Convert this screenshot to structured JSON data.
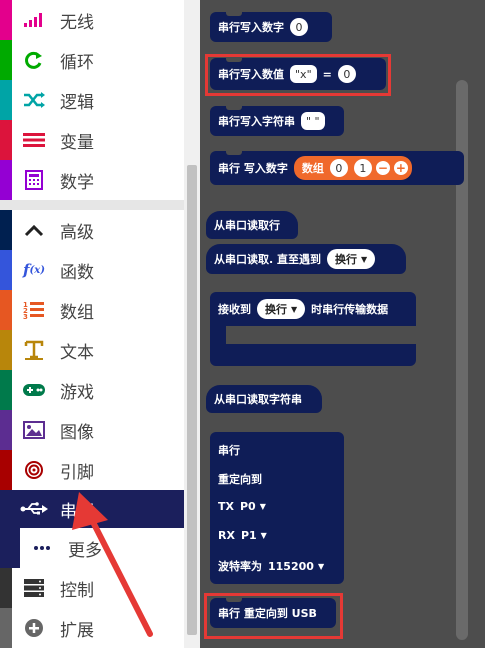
{
  "toolbox": {
    "categories": [
      {
        "label": "无线",
        "icon": "signal-icon",
        "color": "#e3008c"
      },
      {
        "label": "循环",
        "icon": "loop-icon",
        "color": "#00aa00"
      },
      {
        "label": "逻辑",
        "icon": "shuffle-icon",
        "color": "#00a4a6"
      },
      {
        "label": "变量",
        "icon": "list-icon",
        "color": "#dc143c"
      },
      {
        "label": "数学",
        "icon": "calculator-icon",
        "color": "#9400d3"
      },
      {
        "label": "高级",
        "icon": "chevron-up-icon",
        "color": "#002050"
      },
      {
        "label": "函数",
        "icon": "function-icon",
        "color": "#3455db"
      },
      {
        "label": "数组",
        "icon": "array-icon",
        "color": "#e65722"
      },
      {
        "label": "文本",
        "icon": "text-icon",
        "color": "#b8860b"
      },
      {
        "label": "游戏",
        "icon": "gamepad-icon",
        "color": "#007a4b"
      },
      {
        "label": "图像",
        "icon": "image-icon",
        "color": "#5c2d91"
      },
      {
        "label": "引脚",
        "icon": "target-icon",
        "color": "#a80000"
      },
      {
        "label": "串行",
        "icon": "usb-icon",
        "color": "#002050"
      },
      {
        "label": "更多",
        "icon": "more-icon",
        "color": "#002050"
      },
      {
        "label": "控制",
        "icon": "server-icon",
        "color": "#333333"
      },
      {
        "label": "扩展",
        "icon": "add-circle-icon",
        "color": "#666666"
      }
    ]
  },
  "workspace": {
    "blocks": {
      "write_number": {
        "label": "串行写入数字",
        "value": "0"
      },
      "write_value": {
        "label": "串行写入数值",
        "name": "\"x\"",
        "eq": "=",
        "value": "0"
      },
      "write_string": {
        "label": "串行写入字符串",
        "value": "\" \""
      },
      "write_numbers": {
        "label": "串行 写入数字",
        "array_label": "数组",
        "v1": "0",
        "v2": "1"
      },
      "read_line": {
        "label": "从串口读取行"
      },
      "read_until": {
        "label": "从串口读取. 直至遇到",
        "option": "换行"
      },
      "on_receive": {
        "label": "接收到",
        "option": "换行",
        "suffix": "时串行传输数据"
      },
      "read_string": {
        "label": "从串口读取字符串"
      },
      "redirect": {
        "title": "串行",
        "redirect_label": "重定向到",
        "tx_label": "TX",
        "tx_value": "P0",
        "rx_label": "RX",
        "rx_value": "P1",
        "baud_label": "波特率为",
        "baud_value": "115200"
      },
      "redirect_usb": {
        "label": "串行 重定向到 USB"
      }
    }
  },
  "colors": {
    "selected": "#1b1f5c",
    "block": "#0f1d57",
    "workspace": "#4d4d4d",
    "highlight": "#e53935",
    "array": "#f0692b"
  }
}
